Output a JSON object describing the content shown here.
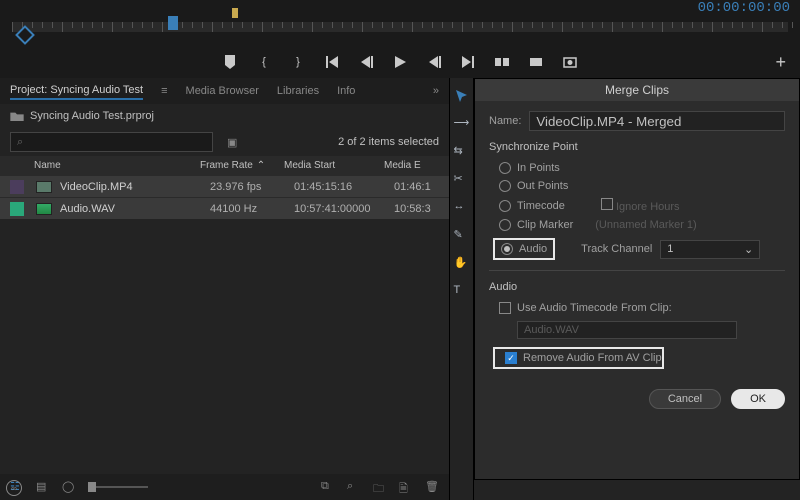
{
  "timecode": "00:00:00:00",
  "transport": {
    "mark_in": "{",
    "mark_out": "}",
    "go_in": "|◀",
    "step_back": "◀|",
    "play": "▶",
    "step_fwd": "|▶",
    "go_out": "▶|",
    "add": "+"
  },
  "project": {
    "tabs": [
      "Project: Syncing Audio Test",
      "Media Browser",
      "Libraries",
      "Info"
    ],
    "active_tab": 0,
    "file": "Syncing Audio Test.prproj",
    "search_placeholder": "",
    "selection": "2 of 2 items selected",
    "columns": [
      "Name",
      "Frame Rate",
      "Media Start",
      "Media E"
    ],
    "rows": [
      {
        "swatch": "purple",
        "name": "VideoClip.MP4",
        "frame_rate": "23.976 fps",
        "media_start": "01:45:15:16",
        "media_end": "01:46:1"
      },
      {
        "swatch": "teal",
        "name": "Audio.WAV",
        "frame_rate": "44100 Hz",
        "media_start": "10:57:41:00000",
        "media_end": "10:58:3"
      }
    ]
  },
  "dialog": {
    "title": "Merge Clips",
    "name_label": "Name:",
    "name_value": "VideoClip.MP4 - Merged",
    "sync_label": "Synchronize Point",
    "radios": {
      "in": "In Points",
      "out": "Out Points",
      "tc": "Timecode",
      "marker": "Clip Marker",
      "audio": "Audio"
    },
    "ignore_hours": "Ignore Hours",
    "unnamed_marker": "(Unnamed Marker 1)",
    "track_channel_label": "Track Channel",
    "track_channel_value": "1",
    "audio_section": "Audio",
    "use_tc": "Use Audio Timecode From Clip:",
    "clip_select": "Audio.WAV",
    "remove_audio": "Remove Audio From AV Clip",
    "cancel": "Cancel",
    "ok": "OK"
  }
}
